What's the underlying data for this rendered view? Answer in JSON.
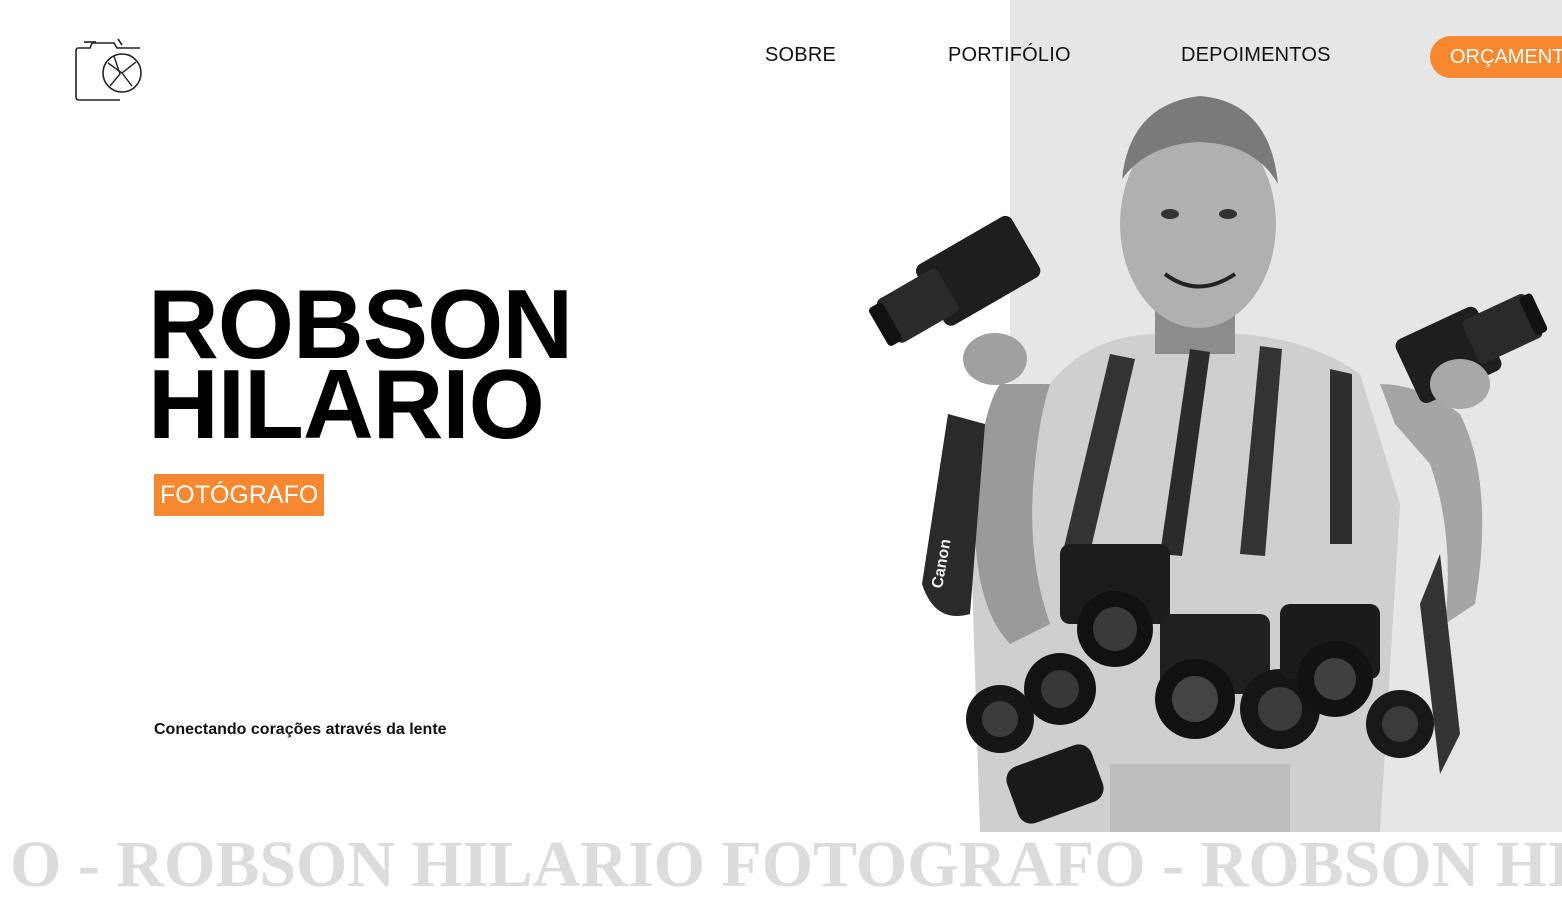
{
  "nav": {
    "items": [
      {
        "label": "SOBRE"
      },
      {
        "label": "PORTIFÓLIO"
      },
      {
        "label": "DEPOIMENTOS"
      }
    ],
    "cta_label": "ORÇAMENTO"
  },
  "hero": {
    "name_line1": "ROBSON",
    "name_line2": "HILARIO",
    "badge": "FOTÓGRAFO",
    "tagline": "Conectando corações através da lente"
  },
  "marquee": {
    "text": "O - ROBSON HILARIO FOTOGRAFO - ROBSON HILARIO"
  },
  "photo": {
    "strap_text": "Canon"
  },
  "colors": {
    "accent": "#f7882f",
    "panel": "#e6e6e6",
    "marquee": "#dcdcdc"
  },
  "icons": {
    "logo": "camera-logo-icon"
  }
}
